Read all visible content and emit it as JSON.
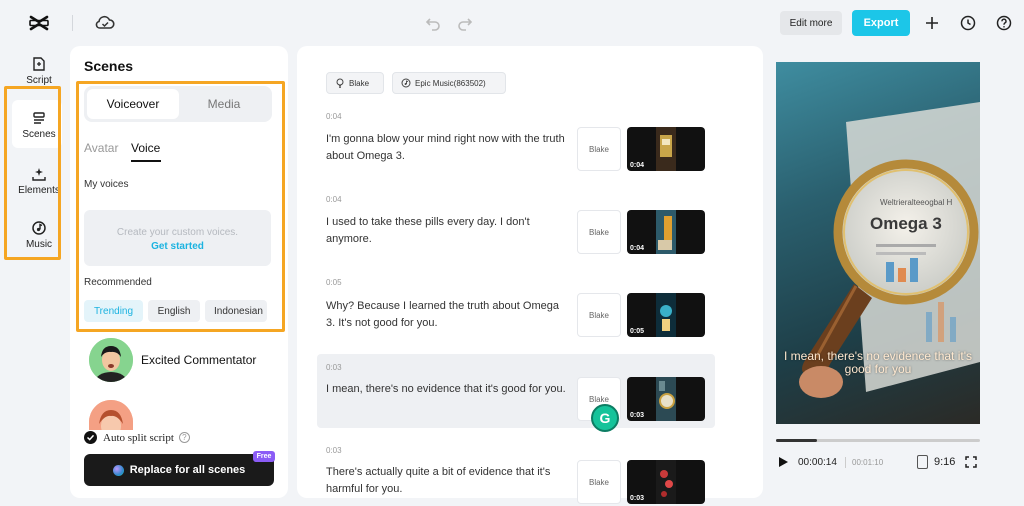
{
  "topbar": {
    "edit_more": "Edit more",
    "export": "Export",
    "accent": "#1cc6e8"
  },
  "rail": {
    "items": [
      {
        "label": "Script",
        "icon": "script-icon"
      },
      {
        "label": "Scenes",
        "icon": "scenes-icon",
        "active": true
      },
      {
        "label": "Elements",
        "icon": "elements-icon"
      },
      {
        "label": "Music",
        "icon": "music-icon"
      }
    ],
    "highlight_color": "#f5a623"
  },
  "scenes_panel": {
    "title": "Scenes",
    "tabs": [
      "Voiceover",
      "Media"
    ],
    "subtabs": [
      "Avatar",
      "Voice"
    ],
    "my_voices": "My voices",
    "custom_voice_text": "Create your custom voices.",
    "get_started": "Get started",
    "recommended": "Recommended",
    "chips": [
      "Trending",
      "English",
      "Indonesian"
    ],
    "voice_name": "Excited Commentator",
    "auto_split": "Auto split script",
    "replace_button": "Replace for all scenes",
    "free_badge": "Free"
  },
  "script": {
    "voice_pill": "Blake",
    "music_pill": "Epic Music(863502)",
    "scenes": [
      {
        "time": "0:04",
        "text": "I'm gonna blow your mind right now with the truth about Omega 3.",
        "voice": "Blake",
        "duration": "0:04"
      },
      {
        "time": "0:04",
        "text": "I used to take these pills every day. I don't anymore.",
        "voice": "Blake",
        "duration": "0:04"
      },
      {
        "time": "0:05",
        "text": "Why? Because I learned the truth about Omega 3. It's not good for you.",
        "voice": "Blake",
        "duration": "0:05"
      },
      {
        "time": "0:03",
        "text": "I mean, there's no evidence that it's good for you.",
        "voice": "Blake",
        "duration": "0:03",
        "selected": true
      },
      {
        "time": "0:03",
        "text": "There's actually quite a bit of evidence that it's harmful for you.",
        "voice": "Blake",
        "duration": "0:03"
      }
    ],
    "grammarly_letter": "G"
  },
  "preview": {
    "caption": "I mean, there's no evidence that it's good for you",
    "sheet_heading": "Weltrieralteeogbal H",
    "sheet_title": "Omega 3",
    "current_time": "00:00:14",
    "total_time": "00:01:10",
    "progress": 0.2,
    "aspect_ratio": "9:16"
  }
}
